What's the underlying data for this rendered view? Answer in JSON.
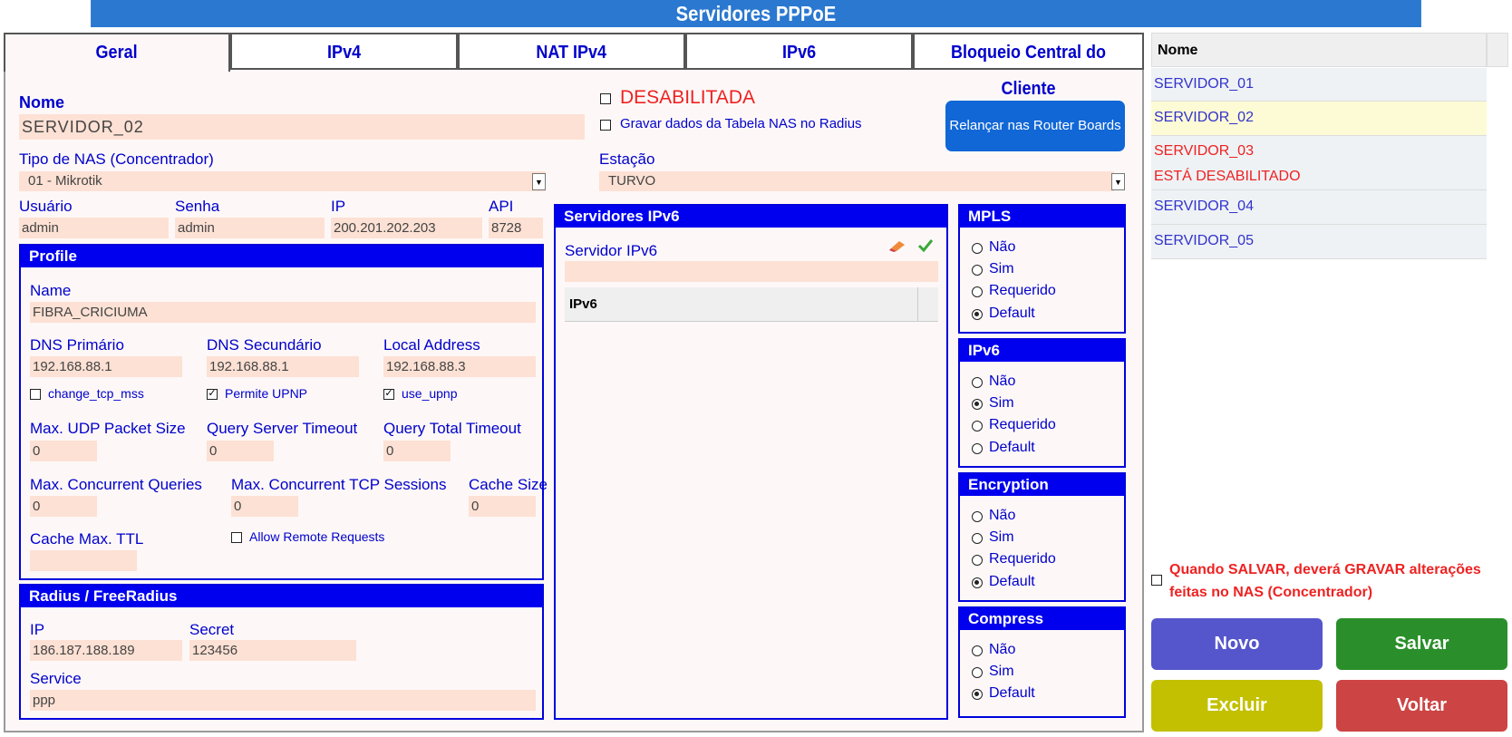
{
  "window": {
    "title": "Servidores PPPoE"
  },
  "tabs": [
    "Geral",
    "IPv4",
    "NAT IPv4",
    "IPv6",
    "Bloqueio Central do Cliente"
  ],
  "geral": {
    "nome_label": "Nome",
    "nome_value": "SERVIDOR_02",
    "desabilitada_label": "DESABILITADA",
    "gravar_nas_label": "Gravar dados da Tabela NAS no Radius",
    "relancar_button": "Relançar nas Router Boards",
    "tipo_nas_label": "Tipo de NAS (Concentrador)",
    "tipo_nas_value": "01 - Mikrotik",
    "estacao_label": "Estação",
    "estacao_value": "TURVO",
    "usuario_label": "Usuário",
    "usuario_value": "admin",
    "senha_label": "Senha",
    "senha_value": "admin",
    "ip_label": "IP",
    "ip_value": "200.201.202.203",
    "api_label": "API",
    "api_value": "8728"
  },
  "profile": {
    "title": "Profile",
    "name_label": "Name",
    "name_value": "FIBRA_CRICIUMA",
    "dns1_label": "DNS Primário",
    "dns1_value": "192.168.88.1",
    "dns2_label": "DNS Secundário",
    "dns2_value": "192.168.88.1",
    "local_label": "Local Address",
    "local_value": "192.168.88.3",
    "change_tcp_label": "change_tcp_mss",
    "permite_upnp_label": "Permite UPNP",
    "use_upnp_label": "use_upnp",
    "udp_label": "Max. UDP Packet Size",
    "udp_value": "0",
    "qst_label": "Query Server Timeout",
    "qst_value": "0",
    "qtt_label": "Query Total Timeout",
    "qtt_value": "0",
    "mcq_label": "Max. Concurrent Queries",
    "mcq_value": "0",
    "mcts_label": "Max. Concurrent TCP Sessions",
    "mcts_value": "0",
    "cache_size_label": "Cache Size",
    "cache_size_value": "0",
    "cache_ttl_label": "Cache Max. TTL",
    "cache_ttl_value": "",
    "allow_remote_label": "Allow Remote Requests"
  },
  "radius": {
    "title": "Radius / FreeRadius",
    "ip_label": "IP",
    "ip_value": "186.187.188.189",
    "secret_label": "Secret",
    "secret_value": "123456",
    "service_label": "Service",
    "service_value": "ppp"
  },
  "ipv6servers": {
    "title": "Servidores IPv6",
    "server_label": "Servidor IPv6",
    "server_value": "",
    "column": "IPv6"
  },
  "mpls": {
    "title": "MPLS",
    "options": [
      "Não",
      "Sim",
      "Requerido",
      "Default"
    ],
    "selected": "Default"
  },
  "ipv6": {
    "title": "IPv6",
    "options": [
      "Não",
      "Sim",
      "Requerido",
      "Default"
    ],
    "selected": "Sim"
  },
  "encryption": {
    "title": "Encryption",
    "options": [
      "Não",
      "Sim",
      "Requerido",
      "Default"
    ],
    "selected": "Default"
  },
  "compress": {
    "title": "Compress",
    "options": [
      "Não",
      "Sim",
      "Default"
    ],
    "selected": "Default"
  },
  "list": {
    "header": "Nome",
    "rows": [
      "SERVIDOR_01",
      "SERVIDOR_02",
      "SERVIDOR_03",
      "SERVIDOR_04",
      "SERVIDOR_05"
    ],
    "disabled_note": "ESTÁ DESABILITADO"
  },
  "save_notice": "Quando SALVAR, deverá GRAVAR alterações feitas no NAS (Concentrador)",
  "buttons": {
    "novo": "Novo",
    "salvar": "Salvar",
    "excluir": "Excluir",
    "voltar": "Voltar"
  },
  "colors": {
    "accent": "#0000ee",
    "title_bar": "#2a78cf",
    "input_bg": "#fde1d4",
    "novo": "#5555cc",
    "salvar": "#2a8f2a",
    "excluir": "#c2c000",
    "voltar": "#cc4444"
  }
}
